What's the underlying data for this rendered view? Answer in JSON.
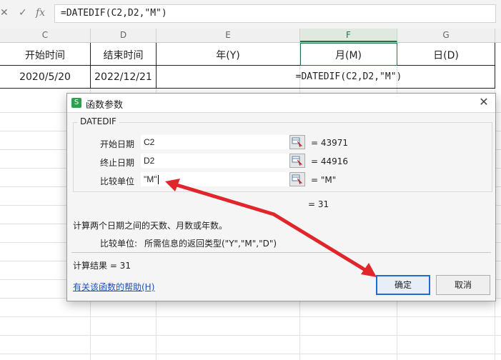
{
  "formula_bar": {
    "cancel_icon": "✕",
    "confirm_icon": "✓",
    "fx_label": "fx",
    "formula": "=DATEDIF(C2,D2,\"M\")"
  },
  "columns": [
    "C",
    "D",
    "E",
    "F",
    "G"
  ],
  "sheet": {
    "headers": [
      "开始时间",
      "结束时间",
      "年(Y)",
      "月(M)",
      "日(D)"
    ],
    "start_date": "2020/5/20",
    "end_date": "2022/12/21",
    "active_formula": "=DATEDIF(C2,D2,\"M\")"
  },
  "dialog": {
    "title": "函数参数",
    "icon_letter": "S",
    "close": "✕",
    "function_name": "DATEDIF",
    "params": [
      {
        "label": "开始日期",
        "value": "C2",
        "result": "=  43971"
      },
      {
        "label": "终止日期",
        "value": "D2",
        "result": "=  44916"
      },
      {
        "label": "比较单位",
        "value": "\"M\"",
        "result": "=  \"M\""
      }
    ],
    "result_line": "=  31",
    "description": "计算两个日期之间的天数、月数或年数。",
    "param_desc_label": "比较单位:",
    "param_desc_text": "所需信息的返回类型(\"Y\",\"M\",\"D\")",
    "calc_result": "计算结果  =  31",
    "help_link": "有关该函数的帮助(H)",
    "ok": "确定",
    "cancel": "取消"
  },
  "annotation_color": "#e0262b"
}
